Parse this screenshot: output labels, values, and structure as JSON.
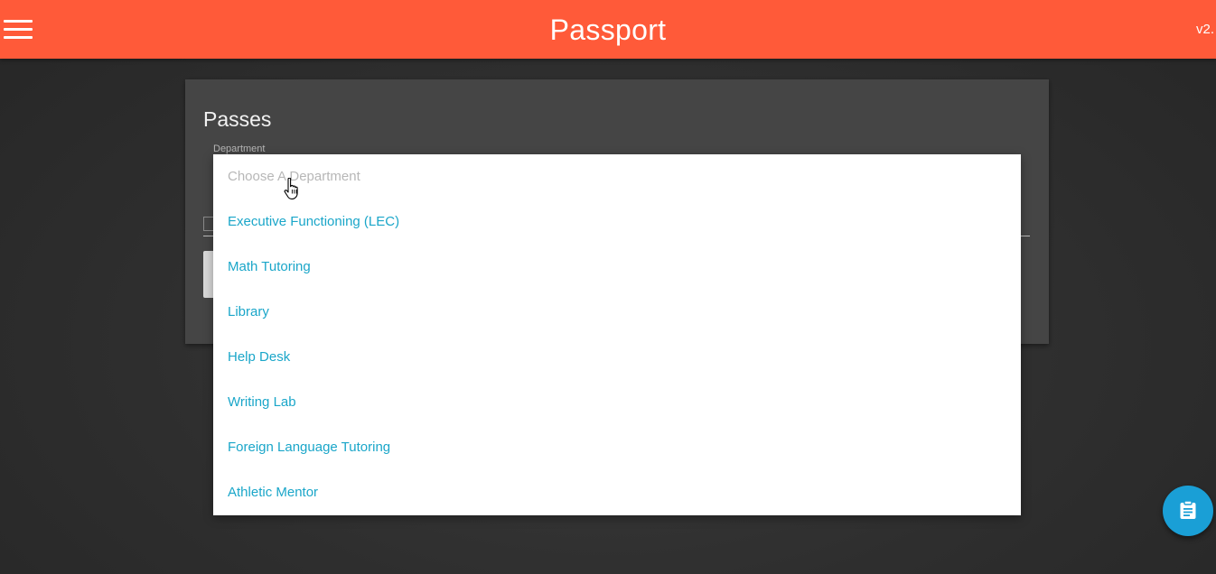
{
  "header": {
    "title": "Passport",
    "version": "v2.",
    "menu_icon": "hamburger-menu-icon",
    "background_color": "#ff5a39"
  },
  "card": {
    "title": "Passes",
    "department_label": "Department"
  },
  "dropdown": {
    "placeholder": "Choose A Department",
    "options": [
      "Executive Functioning (LEC)",
      "Math Tutoring",
      "Library",
      "Help Desk",
      "Writing Lab",
      "Foreign Language Tutoring",
      "Athletic Mentor"
    ],
    "option_color": "#1aa6c9"
  },
  "fab": {
    "icon": "clipboard-icon",
    "color": "#1a9fd6"
  }
}
